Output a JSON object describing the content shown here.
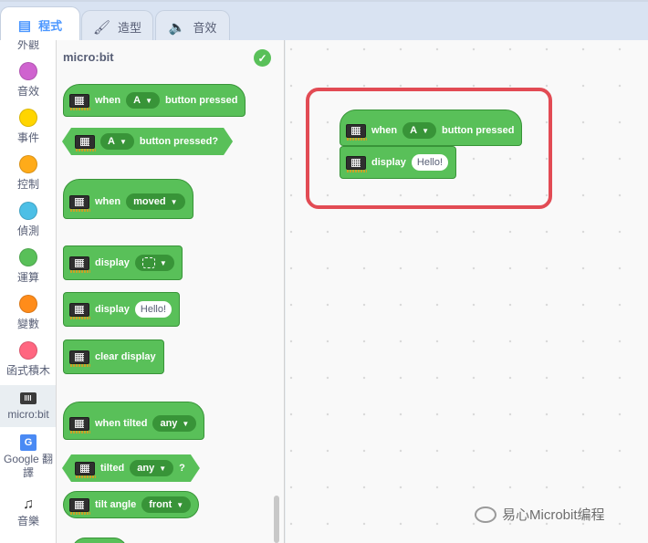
{
  "tabs": [
    {
      "label": "程式",
      "icon": "code-icon",
      "active": true
    },
    {
      "label": "造型",
      "icon": "brush-icon",
      "active": false
    },
    {
      "label": "音效",
      "icon": "speaker-icon",
      "active": false
    }
  ],
  "categories": [
    {
      "label": "外觀",
      "color": "#9966ff"
    },
    {
      "label": "音效",
      "color": "#cf63cf"
    },
    {
      "label": "事件",
      "color": "#ffd500"
    },
    {
      "label": "控制",
      "color": "#ffab19"
    },
    {
      "label": "偵測",
      "color": "#4cbfe6"
    },
    {
      "label": "運算",
      "color": "#59c059"
    },
    {
      "label": "變數",
      "color": "#ff8c1a"
    },
    {
      "label": "函式積木",
      "color": "#ff6680"
    },
    {
      "label": "micro:bit",
      "icon": "microbit-icon"
    },
    {
      "label": "Google 翻譯",
      "icon": "translate-icon"
    },
    {
      "label": "音樂",
      "icon": "music-note-icon"
    }
  ],
  "palette": {
    "title": "micro:bit",
    "blocks": {
      "when_button": {
        "when": "when",
        "button": "A",
        "pressed": "button pressed"
      },
      "button_pressed": {
        "button": "A",
        "label": "button pressed?"
      },
      "when_moved": {
        "when": "when",
        "gesture": "moved"
      },
      "display_pattern": {
        "label": "display"
      },
      "display_text": {
        "label": "display",
        "value": "Hello!"
      },
      "clear_display": {
        "label": "clear display"
      },
      "when_tilted": {
        "label": "when tilted",
        "direction": "any"
      },
      "tilted": {
        "label": "tilted",
        "direction": "any",
        "q": "?"
      },
      "tilt_angle": {
        "label": "tilt angle",
        "direction": "front"
      }
    }
  },
  "workspace": {
    "when_button": {
      "when": "when",
      "button": "A",
      "pressed": "button pressed"
    },
    "display_text": {
      "label": "display",
      "value": "Hello!"
    }
  },
  "watermark": "易心Microbit编程",
  "colors": {
    "block": "#59c059",
    "highlight": "#e24b54",
    "accent": "#4c97ff"
  }
}
